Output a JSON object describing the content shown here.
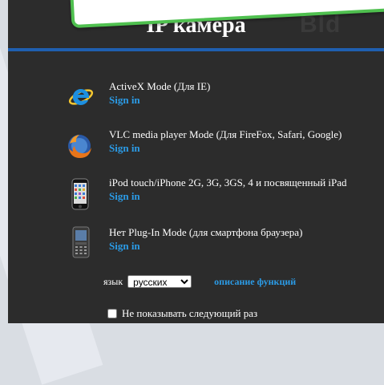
{
  "header": {
    "title": "IP камера",
    "watermark": "Bld"
  },
  "modes": [
    {
      "name": "ActiveX Mode (Для IE)",
      "link": "Sign in",
      "icon": "ie-icon"
    },
    {
      "name": "VLC media player Mode (Для FireFox, Safari, Google)",
      "link": "Sign in",
      "icon": "firefox-icon"
    },
    {
      "name": "iPod touch/iPhone 2G, 3G, 3GS, 4 и посвященный iPad",
      "link": "Sign in",
      "icon": "iphone-icon"
    },
    {
      "name": "Нет Plug-In Mode (для смартфона браузера)",
      "link": "Sign in",
      "icon": "smartphone-icon"
    }
  ],
  "language": {
    "label": "язык",
    "selected": "русских",
    "link": "описание функций"
  },
  "dont_show": {
    "label": "Не показывать следующий раз",
    "checked": false
  },
  "colors": {
    "panel": "#2c2c2c",
    "accent_blue": "#2b9be6",
    "rule_blue": "#1f5fb0",
    "banner_green": "#4fc04f"
  }
}
